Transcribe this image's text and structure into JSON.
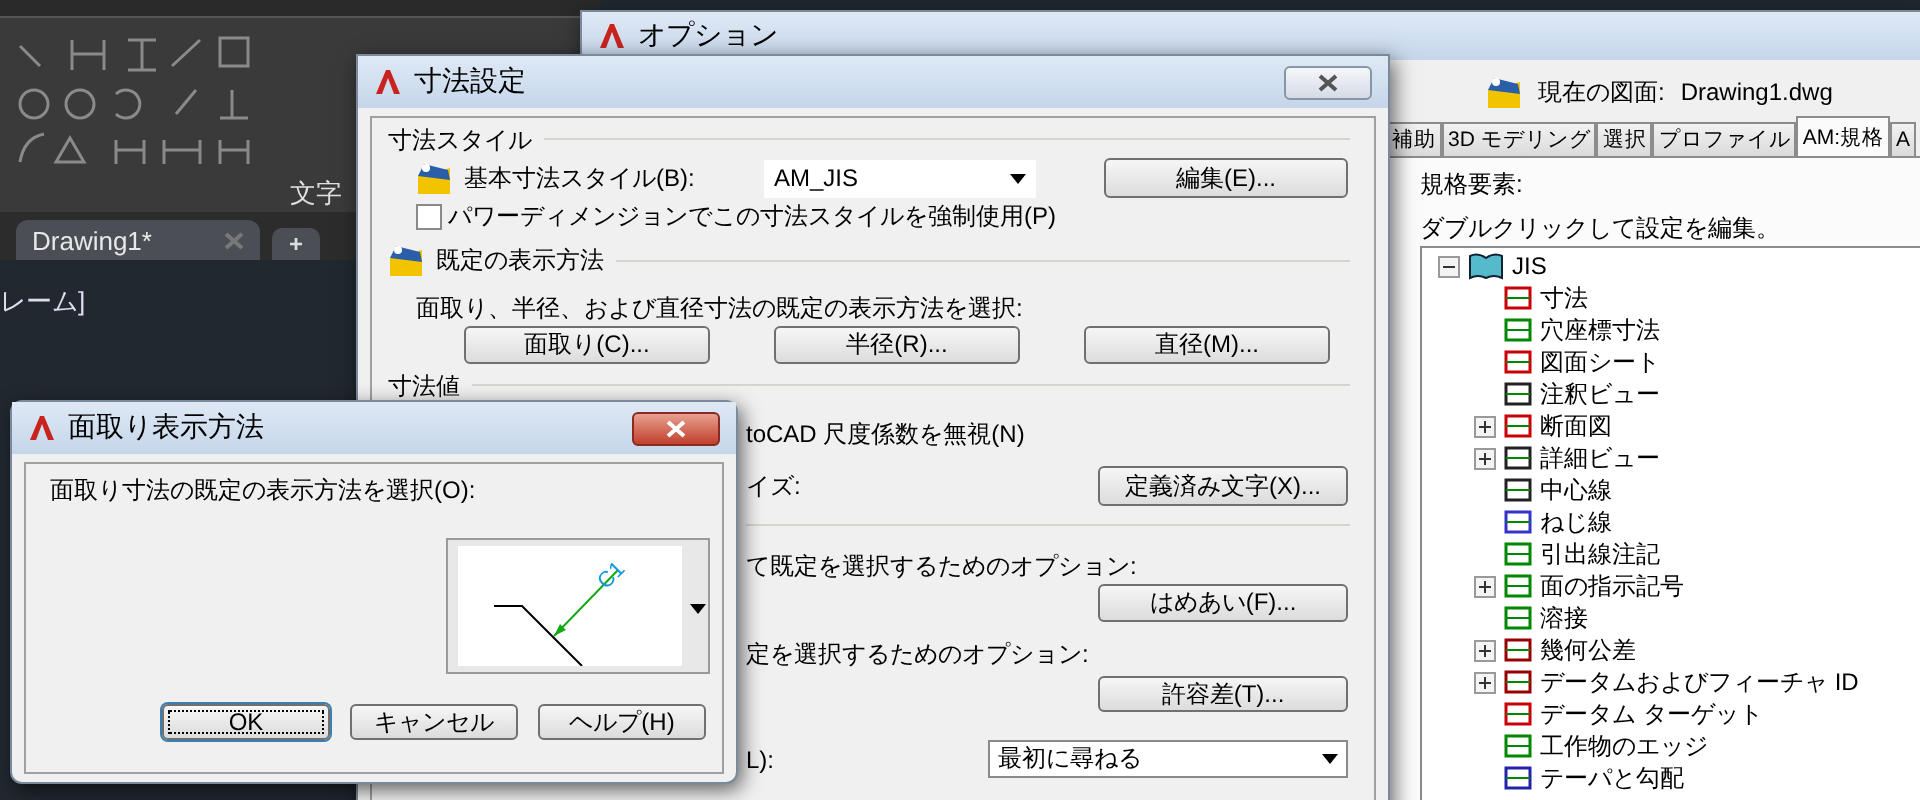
{
  "ribbon": {
    "panel_label": "文字",
    "file_tab": "Drawing1*",
    "new_tab": "+",
    "command_text": "レーム]"
  },
  "options_window": {
    "title": "オプション",
    "current_drawing_label": "現在の図面:",
    "current_drawing": "Drawing1.dwg",
    "tabs": [
      {
        "label": "補助",
        "selected": false
      },
      {
        "label": "3D モデリング",
        "selected": false
      },
      {
        "label": "選択",
        "selected": false
      },
      {
        "label": "プロファイル",
        "selected": false
      },
      {
        "label": "AM:規格",
        "selected": true
      },
      {
        "label": "A",
        "selected": false
      }
    ],
    "elements_label": "規格要素:",
    "hint": "ダブルクリックして設定を編集。",
    "tree": [
      {
        "label": "JIS",
        "expanded": true,
        "children": [
          {
            "label": "寸法"
          },
          {
            "label": "穴座標寸法"
          },
          {
            "label": "図面シート"
          },
          {
            "label": "注釈ビュー"
          },
          {
            "label": "断面図",
            "expanded": false
          },
          {
            "label": "詳細ビュー",
            "expanded": false
          },
          {
            "label": "中心線"
          },
          {
            "label": "ねじ線"
          },
          {
            "label": "引出線注記"
          },
          {
            "label": "面の指示記号",
            "expanded": false
          },
          {
            "label": "溶接"
          },
          {
            "label": "幾何公差",
            "expanded": false
          },
          {
            "label": "データムおよびフィーチャ ID",
            "expanded": false
          },
          {
            "label": "データム ターゲット"
          },
          {
            "label": "工作物のエッジ"
          },
          {
            "label": "テーパと勾配"
          }
        ]
      }
    ]
  },
  "dimension_dialog": {
    "title": "寸法設定",
    "style_section": "寸法スタイル",
    "base_style_label": "基本寸法スタイル(B):",
    "base_style_value": "AM_JIS",
    "edit_button": "編集(E)...",
    "force_checkbox": {
      "label": "パワーディメンジョンでこの寸法スタイルを強制使用(P)",
      "checked": false
    },
    "display_section": "既定の表示方法",
    "display_text": "面取り、半径、および直径寸法の既定の表示方法を選択:",
    "display_buttons": [
      "面取り(C)...",
      "半径(R)...",
      "直径(M)..."
    ],
    "value_section": "寸法値",
    "ignore_scale_text": "toCAD 尺度係数を無視(N)",
    "size_label": "イズ:",
    "predefined_button": "定義済み文字(X)...",
    "fit_text": "て既定を選択するためのオプション:",
    "fit_button": "はめあい(F)...",
    "tolerance_text": "定を選択するためのオプション:",
    "tolerance_button": "許容差(T)...",
    "last_label": "L):",
    "last_value": "最初に尋ねる"
  },
  "chamfer_dialog": {
    "title": "面取り表示方法",
    "prompt": "面取り寸法の既定の表示方法を選択(O):",
    "preview_label": "C1",
    "buttons": [
      {
        "label": "OK",
        "focused": true
      },
      {
        "label": "キャンセル",
        "focused": false
      },
      {
        "label": "ヘルプ(H)",
        "focused": false
      }
    ]
  }
}
